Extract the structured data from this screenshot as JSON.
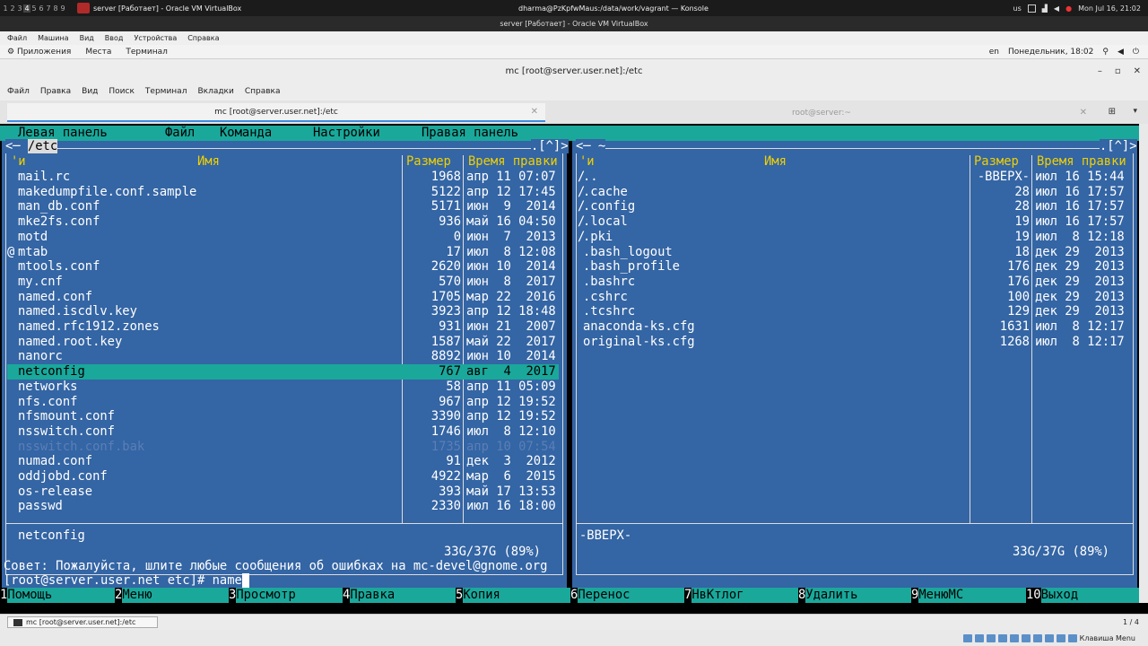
{
  "topbar": {
    "workspaces": [
      "1",
      "2",
      "3",
      "4",
      "5",
      "6",
      "7",
      "8",
      "9"
    ],
    "task1": "server [Работает] - Oracle VM VirtualBox",
    "task2": "dharma@PzKpfwMaus:/data/work/vagrant — Konsole",
    "kbd": "us",
    "clock": "Mon Jul 16, 21:02"
  },
  "vbox": {
    "title": "server [Работает] - Oracle VM VirtualBox",
    "menu": [
      "Файл",
      "Машина",
      "Вид",
      "Ввод",
      "Устройства",
      "Справка"
    ]
  },
  "gnome": {
    "items": [
      "Приложения",
      "Места",
      "Терминал"
    ],
    "lang": "en",
    "datetime": "Понедельник, 18:02"
  },
  "konsole": {
    "title": "mc [root@server.user.net]:/etc",
    "menu": [
      "Файл",
      "Правка",
      "Вид",
      "Поиск",
      "Терминал",
      "Вкладки",
      "Справка"
    ],
    "tabs": [
      "mc [root@server.user.net]:/etc",
      "root@server:~"
    ]
  },
  "mc": {
    "menu": [
      "Левая панель",
      "Файл",
      "Команда",
      "Настройки",
      "Правая панель"
    ],
    "left": {
      "path": "/etc",
      "headers": [
        "'и",
        "Имя",
        "Размер",
        "Время правки"
      ],
      "rows": [
        [
          "",
          "mail.rc",
          "1968",
          "апр 11 07:07"
        ],
        [
          "",
          "makedumpfile.conf.sample",
          "5122",
          "апр 12 17:45"
        ],
        [
          "",
          "man_db.conf",
          "5171",
          "июн  9  2014"
        ],
        [
          "",
          "mke2fs.conf",
          "936",
          "май 16 04:50"
        ],
        [
          "",
          "motd",
          "0",
          "июн  7  2013"
        ],
        [
          "@",
          "mtab",
          "17",
          "июл  8 12:08"
        ],
        [
          "",
          "mtools.conf",
          "2620",
          "июн 10  2014"
        ],
        [
          "",
          "my.cnf",
          "570",
          "июн  8  2017"
        ],
        [
          "",
          "named.conf",
          "1705",
          "мар 22  2016"
        ],
        [
          "",
          "named.iscdlv.key",
          "3923",
          "апр 12 18:48"
        ],
        [
          "",
          "named.rfc1912.zones",
          "931",
          "июн 21  2007"
        ],
        [
          "",
          "named.root.key",
          "1587",
          "май 22  2017"
        ],
        [
          "",
          "nanorc",
          "8892",
          "июн 10  2014"
        ],
        [
          "",
          "netconfig",
          "767",
          "авг  4  2017"
        ],
        [
          "",
          "networks",
          "58",
          "апр 11 05:09"
        ],
        [
          "",
          "nfs.conf",
          "967",
          "апр 12 19:52"
        ],
        [
          "",
          "nfsmount.conf",
          "3390",
          "апр 12 19:52"
        ],
        [
          "",
          "nsswitch.conf",
          "1746",
          "июл  8 12:10"
        ],
        [
          "",
          "nsswitch.conf.bak",
          "1735",
          "апр 10 07:54"
        ],
        [
          "",
          "numad.conf",
          "91",
          "дек  3  2012"
        ],
        [
          "",
          "oddjobd.conf",
          "4922",
          "мар  6  2015"
        ],
        [
          "",
          "os-release",
          "393",
          "май 17 13:53"
        ],
        [
          "",
          "passwd",
          "2330",
          "июл 16 18:00"
        ]
      ],
      "selected_index": 13,
      "dim_index": 18,
      "status": "netconfig",
      "disk": "33G/37G (89%)",
      "corner": ".[^]>"
    },
    "right": {
      "path": "~",
      "headers": [
        "'и",
        "Имя",
        "Размер",
        "Время правки"
      ],
      "rows": [
        [
          "/",
          "..",
          "-ВВЕРХ-",
          "июл 16 15:44"
        ],
        [
          "/",
          ".cache",
          "28",
          "июл 16 17:57"
        ],
        [
          "/",
          ".config",
          "28",
          "июл 16 17:57"
        ],
        [
          "/",
          ".local",
          "19",
          "июл 16 17:57"
        ],
        [
          "/",
          ".pki",
          "19",
          "июл  8 12:18"
        ],
        [
          "",
          ".bash_logout",
          "18",
          "дек 29  2013"
        ],
        [
          "",
          ".bash_profile",
          "176",
          "дек 29  2013"
        ],
        [
          "",
          ".bashrc",
          "176",
          "дек 29  2013"
        ],
        [
          "",
          ".cshrc",
          "100",
          "дек 29  2013"
        ],
        [
          "",
          ".tcshrc",
          "129",
          "дек 29  2013"
        ],
        [
          "",
          "anaconda-ks.cfg",
          "1631",
          "июл  8 12:17"
        ],
        [
          "",
          "original-ks.cfg",
          "1268",
          "июл  8 12:17"
        ]
      ],
      "status": "-ВВЕРХ-",
      "disk": "33G/37G (89%)",
      "corner": ".[^]>"
    },
    "hint": "Совет: Пожалуйста, шлите любые сообщения об ошибках на mc-devel@gnome.org",
    "prompt": "[root@server.user.net etc]# ",
    "command": "name",
    "fkeys": [
      [
        "1",
        "Помощь"
      ],
      [
        "2",
        "Меню"
      ],
      [
        "3",
        "Просмотр"
      ],
      [
        "4",
        "Правка"
      ],
      [
        "5",
        "Копия"
      ],
      [
        "6",
        "Перенос"
      ],
      [
        "7",
        "НвКтлог"
      ],
      [
        "8",
        "Удалить"
      ],
      [
        "9",
        "МенюMC"
      ],
      [
        "10",
        "Выход"
      ]
    ]
  },
  "bottom": {
    "task": "mc [root@server.user.net]:/etc",
    "pager": "1 / 4",
    "tray_label": "Клавиша Menu"
  }
}
